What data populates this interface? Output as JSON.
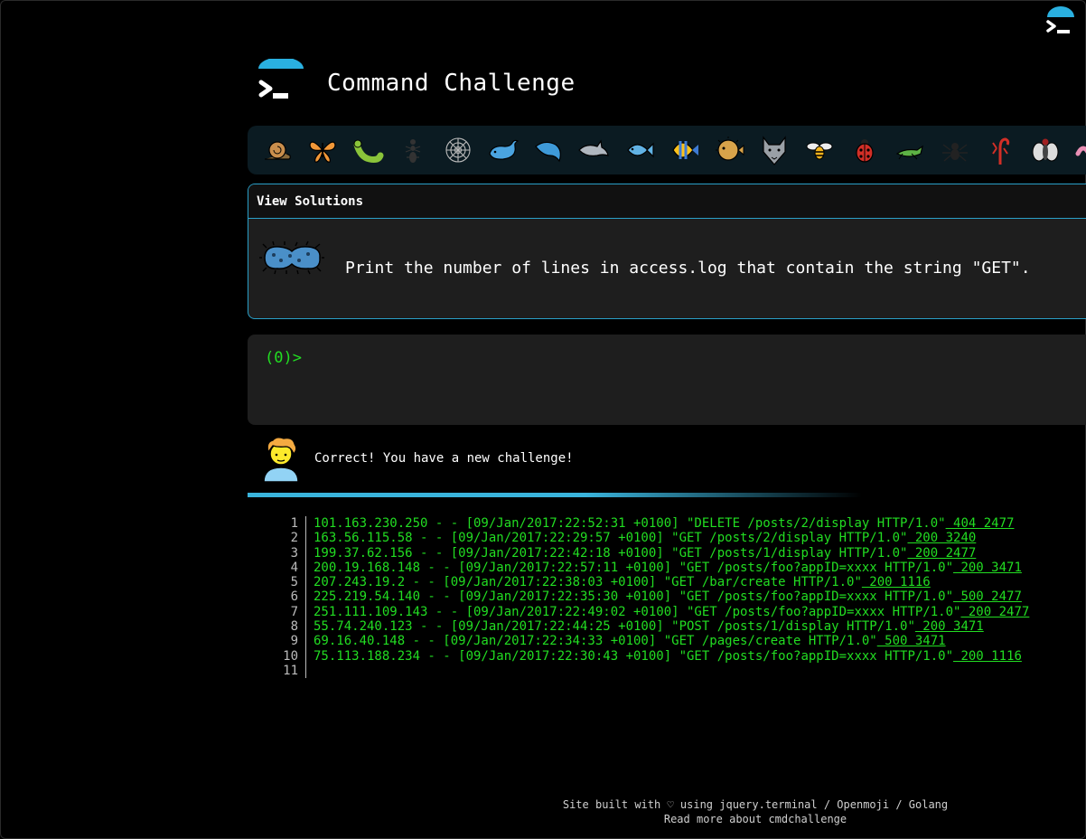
{
  "header": {
    "title": "Command Challenge"
  },
  "strip": {
    "icons": [
      "snail-icon",
      "butterfly-icon",
      "bug-icon",
      "ant-icon",
      "spider-web-icon",
      "whale-icon",
      "dolphin-icon",
      "dolphin-icon",
      "fish-icon",
      "tropical-fish-icon",
      "blowfish-icon",
      "wolf-icon",
      "honeybee-icon",
      "lady-beetle-icon",
      "cricket-icon",
      "spider-icon",
      "scorpion-icon",
      "fly-icon",
      "worm-icon"
    ]
  },
  "card": {
    "view_solutions": "View Solutions",
    "task": "Print the number of lines in access.log that contain the string \"GET\"."
  },
  "terminal": {
    "prompt": "(0)>"
  },
  "feedback": {
    "message": "Correct! You have a new challenge!"
  },
  "log": {
    "lines": [
      {
        "num": "1",
        "text": "101.163.230.250 - - [09/Jan/2017:22:52:31 +0100] \"DELETE /posts/2/display HTTP/1.0\"",
        "status": " 404 2477"
      },
      {
        "num": "2",
        "text": "163.56.115.58 - - [09/Jan/2017:22:29:57 +0100] \"GET /posts/2/display HTTP/1.0\"",
        "status": " 200 3240"
      },
      {
        "num": "3",
        "text": "199.37.62.156 - - [09/Jan/2017:22:42:18 +0100] \"GET /posts/1/display HTTP/1.0\"",
        "status": " 200 2477"
      },
      {
        "num": "4",
        "text": "200.19.168.148 - - [09/Jan/2017:22:57:11 +0100] \"GET /posts/foo?appID=xxxx HTTP/1.0\"",
        "status": " 200 3471"
      },
      {
        "num": "5",
        "text": "207.243.19.2 - - [09/Jan/2017:22:38:03 +0100] \"GET /bar/create HTTP/1.0\"",
        "status": " 200 1116"
      },
      {
        "num": "6",
        "text": "225.219.54.140 - - [09/Jan/2017:22:35:30 +0100] \"GET /posts/foo?appID=xxxx HTTP/1.0\"",
        "status": " 500 2477"
      },
      {
        "num": "7",
        "text": "251.111.109.143 - - [09/Jan/2017:22:49:02 +0100] \"GET /posts/foo?appID=xxxx HTTP/1.0\"",
        "status": " 200 2477"
      },
      {
        "num": "8",
        "text": "55.74.240.123 - - [09/Jan/2017:22:44:25 +0100] \"POST /posts/1/display HTTP/1.0\"",
        "status": " 200 3471"
      },
      {
        "num": "9",
        "text": "69.16.40.148 - - [09/Jan/2017:22:34:33 +0100] \"GET /pages/create HTTP/1.0\"",
        "status": " 500 3471"
      },
      {
        "num": "10",
        "text": "75.113.188.234 - - [09/Jan/2017:22:30:43 +0100] \"GET /posts/foo?appID=xxxx HTTP/1.0\"",
        "status": " 200 1116"
      },
      {
        "num": "11",
        "text": "",
        "status": ""
      }
    ]
  },
  "footer": {
    "line1": "Site built with ♡ using jquery.terminal / Openmoji / Golang",
    "line2": "Read more about cmdchallenge"
  },
  "colors": {
    "accent": "#3ab4dc",
    "prompt_green": "#22dd22",
    "panel": "#1e1e1e"
  }
}
